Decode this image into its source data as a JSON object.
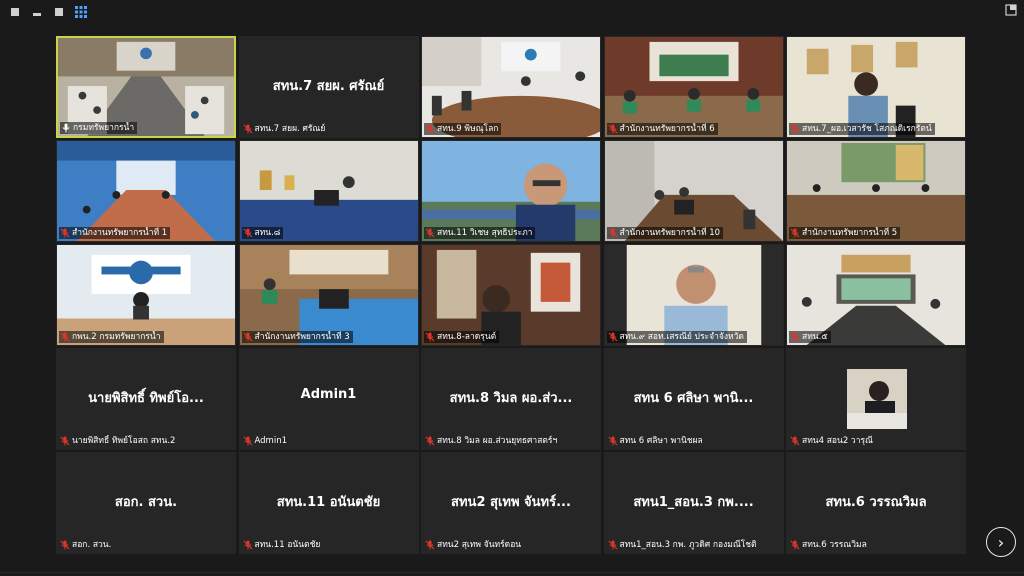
{
  "toolbar": {
    "buttons": [
      {
        "name": "fullscreen-icon",
        "glyph": "▪"
      },
      {
        "name": "minimize-icon",
        "glyph": "▬"
      },
      {
        "name": "restore-icon",
        "glyph": "▪"
      },
      {
        "name": "gallery-view-icon",
        "glyph": "▦"
      }
    ],
    "right_icon": "exit-fullscreen-icon"
  },
  "tiles": [
    {
      "display": "",
      "label": "กรมทรัพยากรน้ำ",
      "video": true,
      "muted": false,
      "active": true,
      "scene": "conference-room"
    },
    {
      "display": "สทน.7 สยผ. ศรัณย์",
      "label": "สทน.7 สยผ. ศรัณย์",
      "video": false,
      "muted": true
    },
    {
      "display": "",
      "label": "สทน.9 พิษณุโลก",
      "video": true,
      "muted": true,
      "scene": "meeting-table"
    },
    {
      "display": "",
      "label": "สำนักงานทรัพยากรน้ำที่ 6",
      "video": true,
      "muted": true,
      "scene": "green-office"
    },
    {
      "display": "",
      "label": "สทน.7_ผอ.เวสารัช โสภณดิเรกรัตน์",
      "video": true,
      "muted": true,
      "scene": "man-at-desk"
    },
    {
      "display": "",
      "label": "สำนักงานทรัพยากรน้ำที่ 1",
      "video": true,
      "muted": true,
      "scene": "blue-hall"
    },
    {
      "display": "",
      "label": "สทน.๘",
      "video": true,
      "muted": true,
      "scene": "white-curtain-room"
    },
    {
      "display": "",
      "label": "สทน.11 วิเชษ สุทธิประภา",
      "video": true,
      "muted": true,
      "scene": "man-outdoor"
    },
    {
      "display": "",
      "label": "สำนักงานทรัพยากรน้ำที่ 10",
      "video": true,
      "muted": true,
      "scene": "gray-room"
    },
    {
      "display": "",
      "label": "สำนักงานทรัพยากรน้ำที่ 5",
      "video": true,
      "muted": true,
      "scene": "hall-portrait"
    },
    {
      "display": "",
      "label": "กพน.2 กรมทรัพยากรน้ำ",
      "video": true,
      "muted": true,
      "scene": "blue-emblem-office"
    },
    {
      "display": "",
      "label": "สำนักงานทรัพยากรน้ำที่ 3",
      "video": true,
      "muted": true,
      "scene": "blue-table-room"
    },
    {
      "display": "",
      "label": "สทน.8-ลาดรุนต์",
      "video": true,
      "muted": true,
      "scene": "window-room"
    },
    {
      "display": "",
      "label": "สทน.๙ สอท.เสรณีย์ ประจำจังหวัด",
      "video": true,
      "muted": true,
      "scene": "man-closeup"
    },
    {
      "display": "",
      "label": "สทน.๕",
      "video": true,
      "muted": true,
      "scene": "long-table"
    },
    {
      "display": "นายพิสิทธิ์ ทิพย์โอ...",
      "label": "นายพิสิทธิ์ ทิพย์โอสถ สทน.2",
      "video": false,
      "muted": true
    },
    {
      "display": "Admin1",
      "label": "Admin1",
      "video": false,
      "muted": true
    },
    {
      "display": "สทน.8 วิมล ผอ.ส่ว...",
      "label": "สทน.8 วิมล ผอ.ส่วนยุทธศาสตร์ฯ",
      "video": false,
      "muted": true
    },
    {
      "display": "สทน 6 ศลิษา พานิ...",
      "label": "สทน 6 ศลิษา พานิชผล",
      "video": false,
      "muted": true
    },
    {
      "display": "",
      "label": "สทน4 สอน2 วารุณี",
      "video": false,
      "muted": true,
      "photo": true
    },
    {
      "display": "สอก. สวน.",
      "label": "สอก. สวน.",
      "video": false,
      "muted": true
    },
    {
      "display": "สทน.11 อนันตชัย",
      "label": "สทน.11 อนันตชัย",
      "video": false,
      "muted": true
    },
    {
      "display": "สทน2 สุเทพ จันทร์...",
      "label": "สทน2 สุเทพ จันทร์ดอน",
      "video": false,
      "muted": true
    },
    {
      "display": "สทน1_สอน.3 กพ....",
      "label": "สทน1_สอน.3 กพ. ภูวดิศ กองมณีโชติ",
      "video": false,
      "muted": true
    },
    {
      "display": "สทน.6 วรรณวิมล",
      "label": "สทน.6 วรรณวิมล",
      "video": false,
      "muted": true
    }
  ],
  "colors": {
    "background": "#1a1a1a",
    "tile": "#262626",
    "active_border": "#c6d64a",
    "muted_icon": "#e0352b"
  },
  "navigation": {
    "next_icon": "chevron-right-icon",
    "next_glyph": "›"
  }
}
